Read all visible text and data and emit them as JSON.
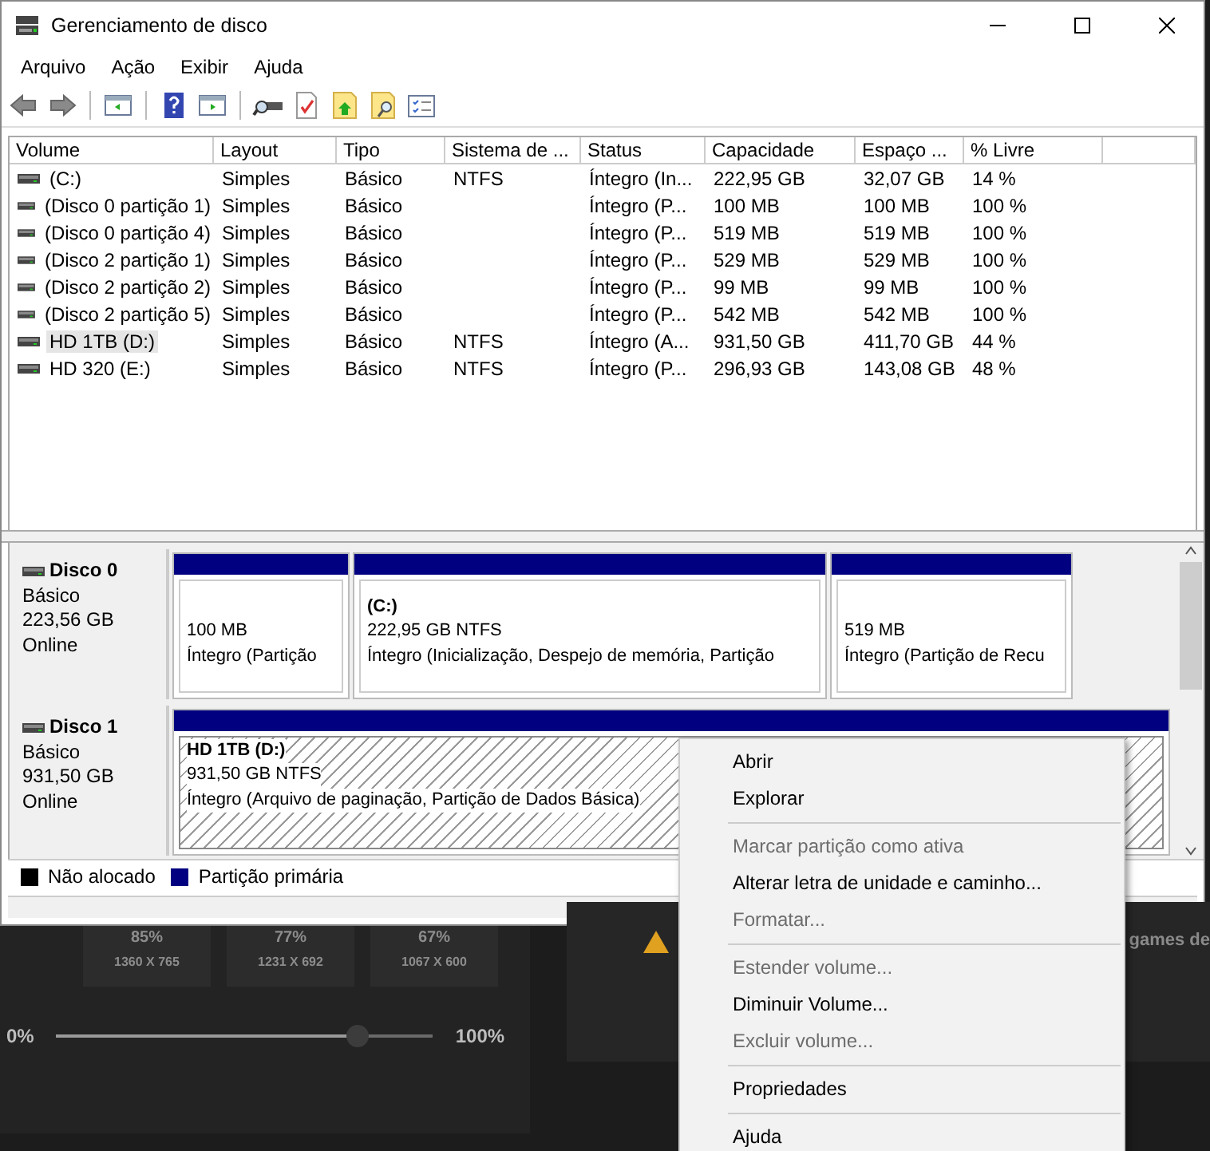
{
  "window": {
    "title": "Gerenciamento de disco"
  },
  "menu": [
    "Arquivo",
    "Ação",
    "Exibir",
    "Ajuda"
  ],
  "volume_table": {
    "columns": [
      "Volume",
      "Layout",
      "Tipo",
      "Sistema de ...",
      "Status",
      "Capacidade",
      "Espaço ...",
      "% Livre"
    ],
    "rows": [
      {
        "selected": false,
        "cells": [
          "(C:)",
          "Simples",
          "Básico",
          "NTFS",
          "Íntegro (In...",
          "222,95 GB",
          "32,07 GB",
          "14 %"
        ]
      },
      {
        "selected": false,
        "cells": [
          "(Disco 0 partição 1)",
          "Simples",
          "Básico",
          "",
          "Íntegro (P...",
          "100 MB",
          "100 MB",
          "100 %"
        ]
      },
      {
        "selected": false,
        "cells": [
          "(Disco 0 partição 4)",
          "Simples",
          "Básico",
          "",
          "Íntegro (P...",
          "519 MB",
          "519 MB",
          "100 %"
        ]
      },
      {
        "selected": false,
        "cells": [
          "(Disco 2 partição 1)",
          "Simples",
          "Básico",
          "",
          "Íntegro (P...",
          "529 MB",
          "529 MB",
          "100 %"
        ]
      },
      {
        "selected": false,
        "cells": [
          "(Disco 2 partição 2)",
          "Simples",
          "Básico",
          "",
          "Íntegro (P...",
          "99 MB",
          "99 MB",
          "100 %"
        ]
      },
      {
        "selected": false,
        "cells": [
          "(Disco 2 partição 5)",
          "Simples",
          "Básico",
          "",
          "Íntegro (P...",
          "542 MB",
          "542 MB",
          "100 %"
        ]
      },
      {
        "selected": true,
        "cells": [
          "HD 1TB (D:)",
          "Simples",
          "Básico",
          "NTFS",
          "Íntegro (A...",
          "931,50 GB",
          "411,70 GB",
          "44 %"
        ]
      },
      {
        "selected": false,
        "cells": [
          "HD 320 (E:)",
          "Simples",
          "Básico",
          "NTFS",
          "Íntegro (P...",
          "296,93 GB",
          "143,08 GB",
          "48 %"
        ]
      }
    ]
  },
  "disks": [
    {
      "name": "Disco 0",
      "type": "Básico",
      "size": "223,56 GB",
      "state": "Online",
      "partitions": [
        {
          "size": "100 MB",
          "status": "Íntegro (Partição",
          "selected": false
        },
        {
          "title": "(C:)",
          "size": "222,95 GB NTFS",
          "status": "Íntegro (Inicialização, Despejo de memória, Partição",
          "selected": false
        },
        {
          "size": "519 MB",
          "status": "Íntegro (Partição de Recu",
          "selected": false
        }
      ]
    },
    {
      "name": "Disco 1",
      "type": "Básico",
      "size": "931,50 GB",
      "state": "Online",
      "partitions": [
        {
          "title": "HD 1TB  (D:)",
          "size": "931,50 GB NTFS",
          "status": "Íntegro (Arquivo de paginação, Partição de Dados Básica)",
          "selected": true
        }
      ]
    }
  ],
  "legend": [
    {
      "label": "Não alocado",
      "color": "#000000"
    },
    {
      "label": "Partição primária",
      "color": "#000080"
    }
  ],
  "context_menu": [
    {
      "kind": "item",
      "label": "Abrir",
      "disabled": false
    },
    {
      "kind": "item",
      "label": "Explorar",
      "disabled": false
    },
    {
      "kind": "separator"
    },
    {
      "kind": "item",
      "label": "Marcar partição como ativa",
      "disabled": true
    },
    {
      "kind": "item",
      "label": "Alterar letra de unidade e caminho...",
      "disabled": false
    },
    {
      "kind": "item",
      "label": "Formatar...",
      "disabled": true
    },
    {
      "kind": "separator"
    },
    {
      "kind": "item",
      "label": "Estender volume...",
      "disabled": true
    },
    {
      "kind": "item",
      "label": "Diminuir Volume...",
      "disabled": false
    },
    {
      "kind": "item",
      "label": "Excluir volume...",
      "disabled": true
    },
    {
      "kind": "separator"
    },
    {
      "kind": "item",
      "label": "Propriedades",
      "disabled": false
    },
    {
      "kind": "separator"
    },
    {
      "kind": "item",
      "label": "Ajuda",
      "disabled": false
    }
  ],
  "background_app": {
    "tiles": [
      {
        "percent": "85%",
        "resolution": "1360 X 765"
      },
      {
        "percent": "77%",
        "resolution": "1231 X 692"
      },
      {
        "percent": "67%",
        "resolution": "1067 X 600"
      }
    ],
    "slider": {
      "min_label": "0%",
      "max_label": "100%",
      "level": 0.8
    },
    "side_text": "games de"
  }
}
